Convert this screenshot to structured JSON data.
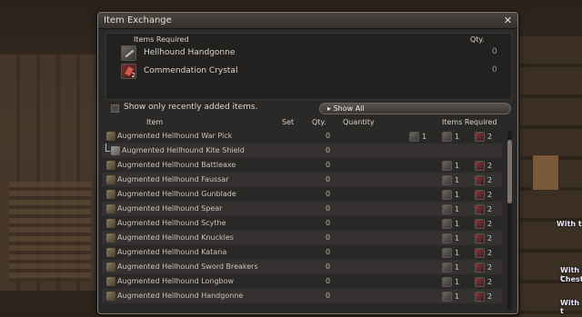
{
  "window": {
    "title": "Item Exchange",
    "close_icon": "close-x-icon"
  },
  "required": {
    "header_items": "Items Required",
    "header_qty": "Qty.",
    "items": [
      {
        "name": "Hellhound Handgonne",
        "qty": "0",
        "icon": "handgonne-icon"
      },
      {
        "name": "Commendation Crystal",
        "qty": "0",
        "icon": "crystal-icon",
        "badge": "2"
      }
    ]
  },
  "filter": {
    "label": "Show only recently added items.",
    "show_all": "Show All"
  },
  "columns": {
    "item": "Item",
    "set": "Set",
    "qty": "Qty.",
    "quantity": "Quantity",
    "items_required": "Items Required"
  },
  "rows": [
    {
      "name": "Augmented Hellhound War Pick",
      "qty": "0",
      "reqs": [
        "1",
        "1",
        "2"
      ]
    },
    {
      "name": "Augmented Hellhound Kite Shield",
      "qty": "0",
      "reqs": [],
      "sub": true
    },
    {
      "name": "Augmented Hellhound Battleaxe",
      "qty": "0",
      "reqs": [
        "1",
        "2"
      ]
    },
    {
      "name": "Augmented Hellhound Faussar",
      "qty": "0",
      "reqs": [
        "1",
        "2"
      ]
    },
    {
      "name": "Augmented Hellhound Gunblade",
      "qty": "0",
      "reqs": [
        "1",
        "2"
      ]
    },
    {
      "name": "Augmented Hellhound Spear",
      "qty": "0",
      "reqs": [
        "1",
        "2"
      ]
    },
    {
      "name": "Augmented Hellhound Scythe",
      "qty": "0",
      "reqs": [
        "1",
        "2"
      ]
    },
    {
      "name": "Augmented Hellhound Knuckles",
      "qty": "0",
      "reqs": [
        "1",
        "2"
      ]
    },
    {
      "name": "Augmented Hellhound Katana",
      "qty": "0",
      "reqs": [
        "1",
        "2"
      ]
    },
    {
      "name": "Augmented Hellhound Sword Breakers",
      "qty": "0",
      "reqs": [
        "1",
        "2"
      ]
    },
    {
      "name": "Augmented Hellhound Longbow",
      "qty": "0",
      "reqs": [
        "1",
        "2"
      ]
    },
    {
      "name": "Augmented Hellhound Handgonne",
      "qty": "0",
      "reqs": [
        "1",
        "2"
      ]
    }
  ],
  "side_texts": [
    "With t",
    "With t",
    "Chest,",
    "With t"
  ]
}
